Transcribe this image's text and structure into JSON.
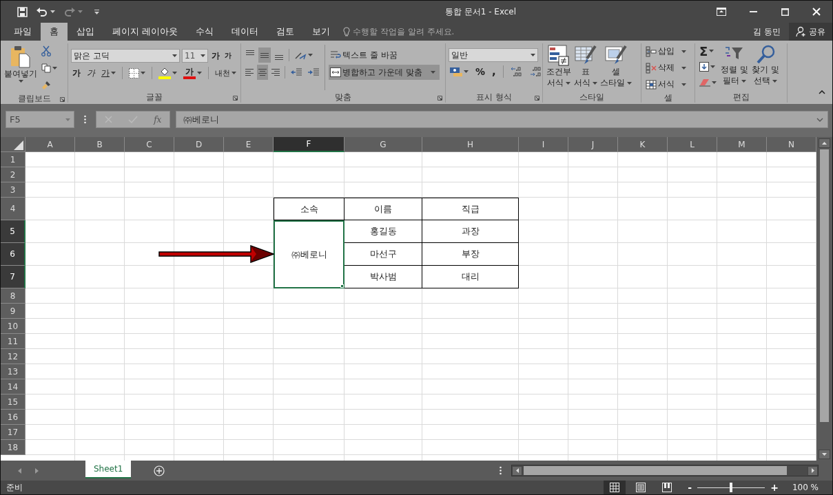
{
  "window": {
    "title": "통합 문서1 - Excel"
  },
  "menu_tabs": [
    {
      "label": "파일",
      "selected": false
    },
    {
      "label": "홈",
      "selected": true
    },
    {
      "label": "삽입",
      "selected": false
    },
    {
      "label": "페이지 레이아웃",
      "selected": false
    },
    {
      "label": "수식",
      "selected": false
    },
    {
      "label": "데이터",
      "selected": false
    },
    {
      "label": "검토",
      "selected": false
    },
    {
      "label": "보기",
      "selected": false
    }
  ],
  "tell_me": {
    "placeholder": "수행할 작업을 알려 주세요."
  },
  "account": {
    "user": "김 동민",
    "share": "공유"
  },
  "ribbon": {
    "clipboard": {
      "label": "클립보드",
      "paste": "붙여넣기"
    },
    "font": {
      "label": "글꼴",
      "font_name": "맑은 고딕",
      "font_size": "11",
      "grow": "가",
      "shrink": "가",
      "bold": "가",
      "italic": "가",
      "underline": "가",
      "font_color": "가",
      "phonetic": "내천"
    },
    "alignment": {
      "label": "맞춤",
      "vertical_align": [
        {
          "selected": false
        },
        {
          "selected": true
        },
        {
          "selected": false
        }
      ],
      "horizontal_align": [
        {
          "selected": false
        },
        {
          "selected": true
        },
        {
          "selected": false
        }
      ],
      "wrap_text": {
        "label": "텍스트 줄 바꿈",
        "selected": false
      },
      "merge_center": {
        "label": "병합하고 가운데 맞춤",
        "selected": true
      }
    },
    "number": {
      "label": "표시 형식",
      "format": "일반",
      "percent": "%",
      "comma": ","
    },
    "styles": {
      "label": "스타일",
      "buttons": [
        [
          "조건부",
          "서식"
        ],
        [
          "표",
          "서식"
        ],
        [
          "셀",
          "스타일"
        ]
      ]
    },
    "cells": {
      "label": "셀",
      "buttons": [
        "삽입",
        "삭제",
        "서식"
      ]
    },
    "editing": {
      "label": "편집",
      "autosum": "Σ",
      "buttons": [
        [
          "정렬 및",
          "필터"
        ],
        [
          "찾기 및",
          "선택"
        ]
      ]
    }
  },
  "formula_bar": {
    "name_box": "F5",
    "function_label": "fx",
    "formula": "㈜베로니"
  },
  "sheet": {
    "columns": [
      {
        "label": "A",
        "selected": false
      },
      {
        "label": "B",
        "selected": false
      },
      {
        "label": "C",
        "selected": false
      },
      {
        "label": "D",
        "selected": false
      },
      {
        "label": "E",
        "selected": false
      },
      {
        "label": "F",
        "selected": true
      },
      {
        "label": "G",
        "selected": false
      },
      {
        "label": "H",
        "selected": false
      },
      {
        "label": "I",
        "selected": false
      },
      {
        "label": "J",
        "selected": false
      },
      {
        "label": "K",
        "selected": false
      },
      {
        "label": "L",
        "selected": false
      },
      {
        "label": "M",
        "selected": false
      },
      {
        "label": "N",
        "selected": false
      }
    ],
    "rows": [
      {
        "label": "1",
        "selected": false
      },
      {
        "label": "2",
        "selected": false
      },
      {
        "label": "3",
        "selected": false
      },
      {
        "label": "4",
        "selected": false
      },
      {
        "label": "5",
        "selected": true
      },
      {
        "label": "6",
        "selected": true
      },
      {
        "label": "7",
        "selected": true
      },
      {
        "label": "8",
        "selected": false
      },
      {
        "label": "9",
        "selected": false
      },
      {
        "label": "10",
        "selected": false
      },
      {
        "label": "11",
        "selected": false
      },
      {
        "label": "12",
        "selected": false
      },
      {
        "label": "13",
        "selected": false
      },
      {
        "label": "14",
        "selected": false
      },
      {
        "label": "15",
        "selected": false
      },
      {
        "label": "16",
        "selected": false
      },
      {
        "label": "17",
        "selected": false
      },
      {
        "label": "18",
        "selected": false
      }
    ],
    "table": {
      "header": [
        "소속",
        "이름",
        "직급"
      ],
      "group": {
        "text": "㈜베로니",
        "selected": true
      },
      "rows": [
        [
          "홍길동",
          "과장"
        ],
        [
          "마선구",
          "부장"
        ],
        [
          "박사범",
          "대리"
        ]
      ]
    }
  },
  "sheet_tabs": [
    {
      "label": "Sheet1",
      "selected": true
    }
  ],
  "status_bar": {
    "status": "준비",
    "views": [
      {
        "kind": "normal",
        "selected": true
      },
      {
        "kind": "page-layout",
        "selected": false
      },
      {
        "kind": "page-break",
        "selected": false
      }
    ],
    "zoom_out": "-",
    "zoom_in": "+",
    "zoom": {
      "level": 0.5
    },
    "zoom_label": "100 %"
  }
}
